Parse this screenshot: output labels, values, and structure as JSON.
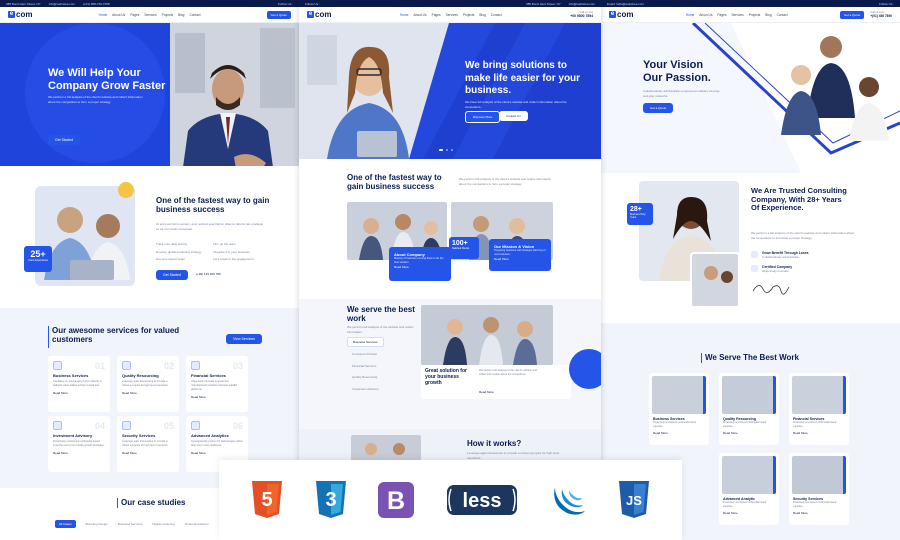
{
  "panel1": {
    "topbar": [
      "288 Bond Hent Street, NY",
      "info@websitea.com",
      "(+01) 958-746-7458",
      "Follow Us :"
    ],
    "nav": {
      "links": [
        "Home",
        "About Us",
        "Pages",
        "Services",
        "Projects",
        "Blog",
        "Contact"
      ],
      "cta": "Get a Quote"
    },
    "logo": "com",
    "hero": {
      "title": "We Will Help Your Company Grow Faster",
      "subtitle": "We perform a full analysis of the client's website and collect information about the competitors to form a proper strategy.",
      "button": "Get Started"
    },
    "about": {
      "title": "One of the fastest way to gain business success",
      "text": "Ut enim ad minim veniam, quis nostrud exercitation ullamco laboris nisi ut aliquip ex ea commodo consequat.",
      "badge_number": "25+",
      "badge_text": "Years Experience",
      "features": [
        "Track your daily activity",
        "Firm up the team",
        "Develop global marketing strategy",
        "Integrate it in your business",
        "Get and support team",
        "Let's break to the engagement"
      ],
      "button": "Get Started",
      "phone": "(+99) 123 456 789"
    },
    "services": {
      "title": "Our awesome services for valued customers",
      "button": "View Services",
      "cards": [
        {
          "num": "01",
          "title": "Business Services",
          "text": "Capitalise on low hanging fruit to identify a ballpark value added activity to beta test.",
          "link": "Read More"
        },
        {
          "num": "02",
          "title": "Quality Resourcing",
          "text": "Leverage agile frameworks to provide a robust synopsis for high level overviews.",
          "link": "Read More"
        },
        {
          "num": "03",
          "title": "Financial Services",
          "text": "Objectively innovate empowered manufactured products whereas parallel platforms.",
          "link": "Read More"
        },
        {
          "num": "04",
          "title": "Investment Advisory",
          "text": "Proactively envisioned multimedia based expertise and cross-media growth strategies.",
          "link": "Read More"
        },
        {
          "num": "05",
          "title": "Security Services",
          "text": "Leverage agile frameworks to provide a robust synopsis for high level overviews.",
          "link": "Read More"
        },
        {
          "num": "06",
          "title": "Advanced Analytics",
          "text": "Synergistically evolve 2.0 technologies rather than just in web-readiness.",
          "link": "Read More"
        }
      ]
    },
    "case_studies": {
      "title": "Our case studies",
      "tabs": [
        "All Cases",
        "Branding Design",
        "Business Services",
        "Digital marketing",
        "Financial advisory"
      ]
    }
  },
  "panel2": {
    "topbar": [
      "Follow Us :",
      "385 Bond Hent Street, NY",
      "info@websitea.com"
    ],
    "logo": "com",
    "nav": {
      "links": [
        "Home",
        "About Us",
        "Pages",
        "Services",
        "Projects",
        "Blog",
        "Contact"
      ],
      "phone_label": "Call us now",
      "phone": "+00 9800 7894"
    },
    "hero": {
      "title": "We bring solutions to make life easier for your business.",
      "subtitle": "We have full analysis of the client's website and collect information about the competitors.",
      "button_primary": "Discover More",
      "button_secondary": "Contact Us"
    },
    "fastest": {
      "title": "One of the fastest way to gain business success",
      "text": "We perform full analysis of the client's website and collect information about the competitors to form a proper strategy.",
      "card1_title": "About Company",
      "card1_text": "Mission of business running flows to do the best solution.",
      "card1_link": "Read More",
      "stat": "100+",
      "stat_label": "Satisfied Clients",
      "card2_title": "Our Mission & Vision",
      "card2_text": "Preparing business with strategic planning of new business.",
      "card2_link": "Read More"
    },
    "best_work": {
      "title": "We serve the best work",
      "text": "We perform full analysis of the website and collect information.",
      "items": [
        "Business Services",
        "Consumer Product",
        "Financial Services",
        "Quality Resourcing",
        "Investment Advisory"
      ],
      "box_title": "Great solution for your business growth",
      "box_text": "We perform full analysis of the client's website and collect information about the competitors.",
      "box_link": "Read More"
    },
    "how": {
      "title": "How it works?",
      "text": "Leverage agile frameworks to provide a robust synopsis for high level overviews."
    }
  },
  "panel3": {
    "topbar": [
      "Email: hello@websitea.com",
      "Follow Us :"
    ],
    "logo": "com",
    "nav": {
      "links": [
        "Home",
        "About Us",
        "Pages",
        "Services",
        "Projects",
        "Blog",
        "Contact"
      ],
      "cta": "Get a Quote",
      "phone_label": "Call us now",
      "phone": "+(01) 456 7890"
    },
    "hero": {
      "title": "Your Vision Our Passion.",
      "subtitle": "Collaboratively administrate empowered markets via plug-and-play networks.",
      "button": "Get a Quote"
    },
    "trusted": {
      "title": "We Are Trusted Consulting Company, With 28+ Years Of Experience.",
      "text": "We perform a full analysis of the client's website and collect information about the competitors to formulate a proper strategy.",
      "badge_number": "28+",
      "badge_text": "Business Help Years",
      "item1_title": "Grow Benefit Through Loses",
      "item1_text": "Collaboratively administrate",
      "item2_title": "Certified Company",
      "item2_text": "Objectively innovate"
    },
    "best_work": {
      "title": "We Serve The Best Work",
      "cards": [
        {
          "title": "Business Services",
          "text": "Proactively envisioned multimedia based expertise.",
          "link": "Read More"
        },
        {
          "title": "Quality Resourcing",
          "text": "Proactively envisioned multimedia based expertise.",
          "link": "Read More"
        },
        {
          "title": "Financial Services",
          "text": "Proactively envisioned multimedia based expertise.",
          "link": "Read More"
        },
        {
          "title": "",
          "text": "",
          "link": ""
        },
        {
          "title": "Advanced Analytic",
          "text": "Proactively envisioned multimedia based expertise.",
          "link": "Read More"
        },
        {
          "title": "Security Services",
          "text": "Proactively envisioned multimedia based expertise.",
          "link": "Read More"
        }
      ]
    }
  },
  "badges": [
    {
      "name": "HTML5",
      "glyph": "5",
      "color": "#e34f26"
    },
    {
      "name": "CSS3",
      "glyph": "3",
      "color": "#1572b6"
    },
    {
      "name": "Bootstrap",
      "glyph": "B",
      "color": "#7952b3"
    },
    {
      "name": "LESS",
      "glyph": "less",
      "color": "#1d365d"
    },
    {
      "name": "jQuery",
      "glyph": "",
      "color": "#0769ad"
    },
    {
      "name": "JavaScript",
      "glyph": "JS",
      "color": "#1f5ca8"
    }
  ]
}
